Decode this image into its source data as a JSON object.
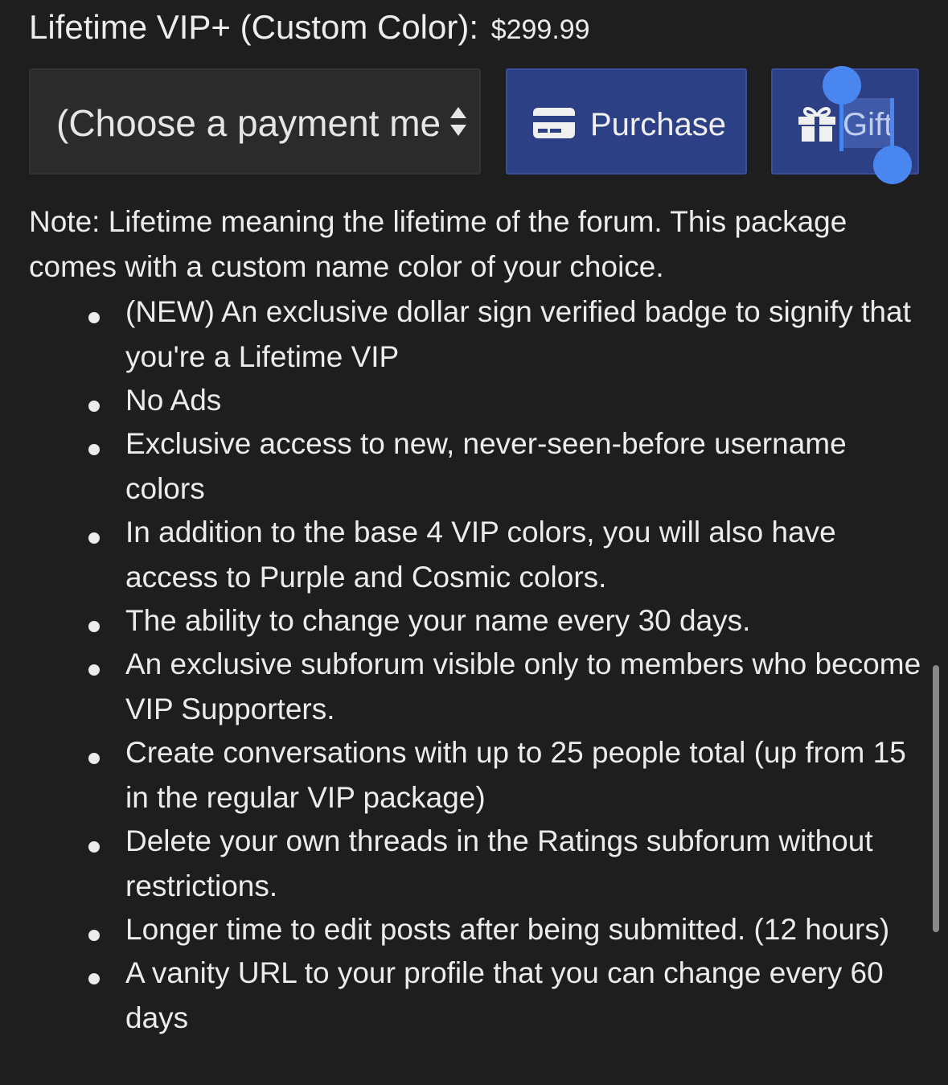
{
  "package": {
    "title": "Lifetime VIP+ (Custom Color):",
    "price": "$299.99"
  },
  "payment_select": {
    "selected_value": "(Choose a payment method)"
  },
  "buttons": {
    "purchase_label": "Purchase",
    "gift_label": "Gift"
  },
  "icons": {
    "purchase": "credit-card-icon",
    "gift": "gift-icon",
    "select": "sort-arrows-icon"
  },
  "colors": {
    "background": "#1e1e1e",
    "button": "#2d3f85",
    "selection_handle": "#4a86f0"
  },
  "note": "Note: Lifetime meaning the lifetime of the forum. This package comes with a custom name color of your choice.",
  "features": [
    "(NEW) An exclusive dollar sign verified badge to signify that you're a Lifetime VIP",
    "No Ads",
    "Exclusive access to new, never-seen-before username colors",
    "In addition to the base 4 VIP colors, you will also have access to Purple and Cosmic colors.",
    "The ability to change your name every 30 days.",
    "An exclusive subforum visible only to members who become VIP Supporters.",
    "Create conversations with up to 25 people total (up from 15 in the regular VIP package)",
    "Delete your own threads in the Ratings subforum without restrictions.",
    "Longer time to edit posts after being submitted. (12 hours)",
    "A vanity URL to your profile that you can change every 60 days"
  ]
}
